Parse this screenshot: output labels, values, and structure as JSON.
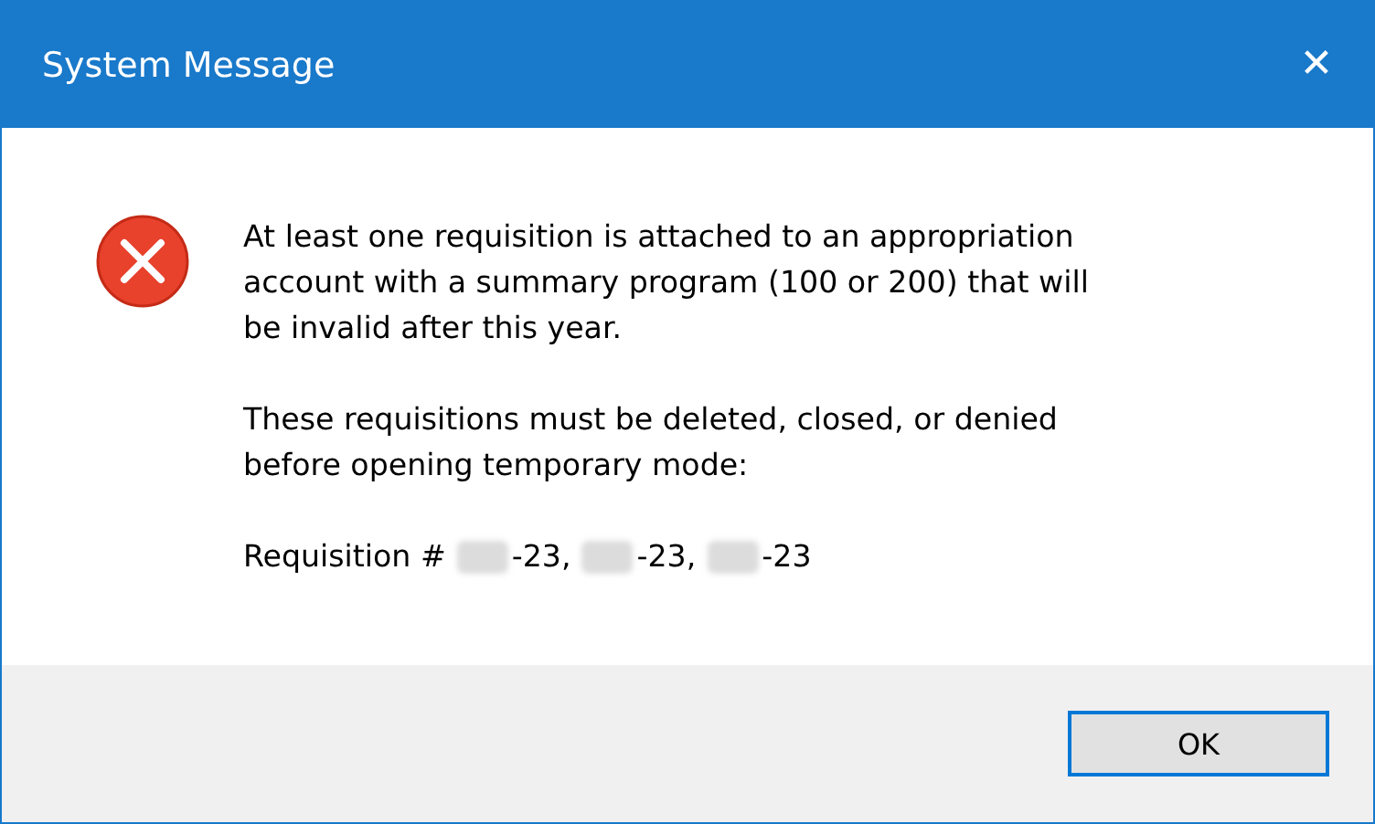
{
  "window": {
    "title": "System Message",
    "close": "✕"
  },
  "message": {
    "kind": "error",
    "paragraphs": [
      "At least one requisition is attached to an appropriation\naccount with a summary program (100 or 200) that will\nbe invalid after this year.",
      "These requisitions must be deleted, closed, or denied\nbefore opening temporary mode:"
    ],
    "requisition": {
      "label": "Requisition #",
      "numbers": [
        "-23,",
        "-23,",
        "-23"
      ]
    }
  },
  "buttons": [
    {
      "label": "OK",
      "focused": true
    }
  ]
}
